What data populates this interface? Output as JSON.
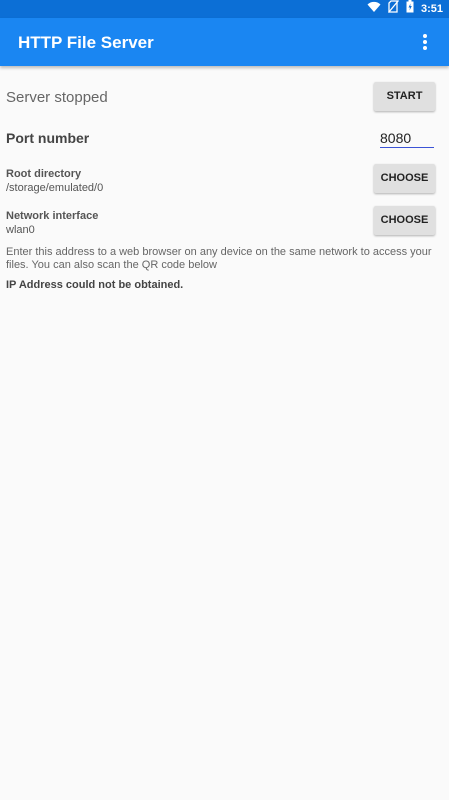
{
  "status_bar": {
    "time": "3:51",
    "icons": [
      "wifi-icon",
      "no-sim-icon",
      "battery-icon"
    ]
  },
  "app_bar": {
    "title": "HTTP File Server",
    "menu_icon": "more-vert-icon"
  },
  "server": {
    "status": "Server stopped",
    "start_label": "START"
  },
  "port": {
    "label": "Port number",
    "value": "8080"
  },
  "root_directory": {
    "label": "Root directory",
    "value": "/storage/emulated/0",
    "button_label": "CHOOSE"
  },
  "network_interface": {
    "label": "Network interface",
    "value": "wlan0",
    "button_label": "CHOOSE"
  },
  "info": {
    "text": "Enter this address to a web browser on any device on the same network to access your files. You can also scan the QR code below",
    "ip_message": "IP Address could not be obtained."
  },
  "colors": {
    "status_bar": "#0c6fd6",
    "app_bar": "#1a86f2",
    "accent": "#3b53d6",
    "background": "#fafafa"
  }
}
